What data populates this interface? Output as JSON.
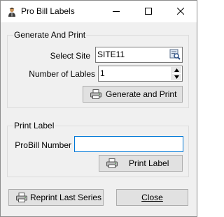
{
  "window": {
    "title": "Pro Bill Labels",
    "icon": "user-worker-icon"
  },
  "generate_group": {
    "title": "Generate And Print",
    "select_site_label": "Select Site",
    "site_value": "SITE11",
    "browse_icon": "search-lookup-icon",
    "number_of_labels_label": "Number of Lables",
    "number_of_labels_value": "1",
    "generate_button_label": "Generate and Print",
    "generate_button_icon": "printer-icon"
  },
  "print_group": {
    "title": "Print Label",
    "probill_label": "ProBill Number",
    "probill_value": "",
    "print_button_label": "Print Label",
    "print_button_icon": "printer-icon"
  },
  "footer": {
    "reprint_button_label": "Reprint Last Series",
    "reprint_button_icon": "printer-icon",
    "close_button_label": "Close"
  },
  "colors": {
    "window_bg": "#f0f0f0",
    "button_bg": "#e1e1e1",
    "focus_border": "#0078d7"
  }
}
